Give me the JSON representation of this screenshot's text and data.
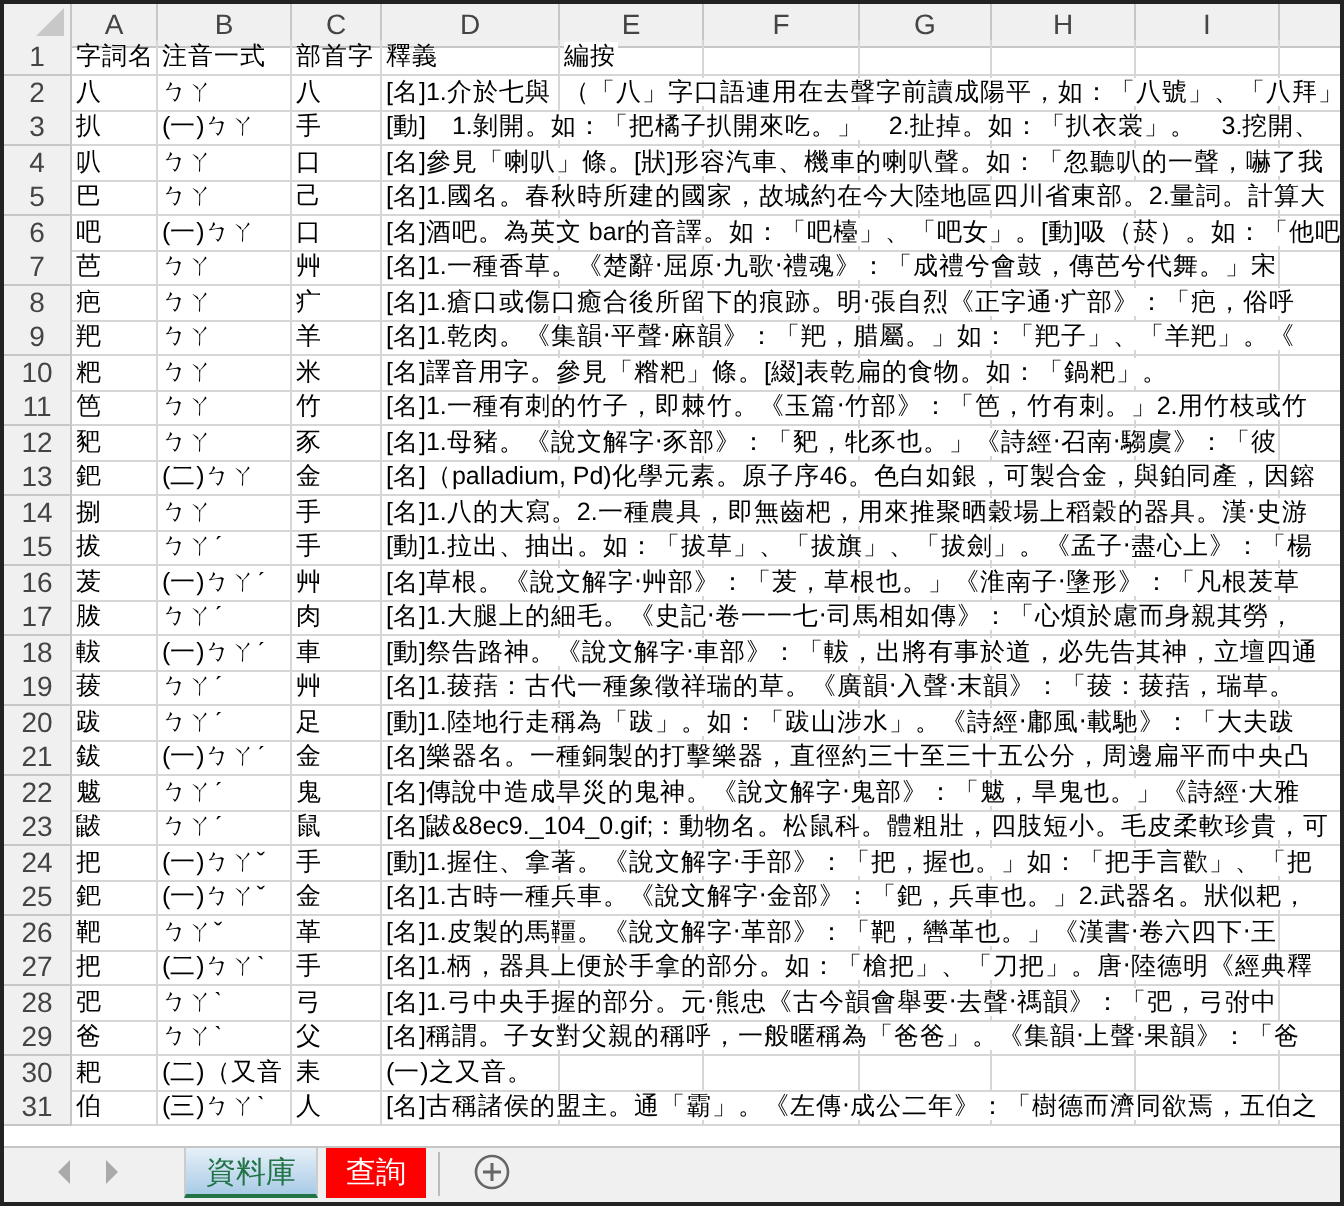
{
  "columns": [
    "A",
    "B",
    "C",
    "D",
    "E",
    "F",
    "G",
    "H",
    "I"
  ],
  "rows": [
    {
      "row_number": "1",
      "word": "字詞名",
      "zhuyin": "注音一式",
      "radical": "部首字",
      "definition": "釋義",
      "note": "編按"
    },
    {
      "row_number": "2",
      "word": "八",
      "zhuyin": "ㄅㄚ",
      "radical": "八",
      "definition": "[名]1.介於七與",
      "note": "（「八」字口語連用在去聲字前讀成陽平，如：「八號」、「八拜」"
    },
    {
      "row_number": "3",
      "word": "扒",
      "zhuyin": "(一)ㄅㄚ",
      "radical": "手",
      "definition": "[動]　1.剝開。如：「把橘子扒開來吃。」　2.扯掉。如：「扒衣裳」。　3.挖開、"
    },
    {
      "row_number": "4",
      "word": "叭",
      "zhuyin": "ㄅㄚ",
      "radical": "口",
      "definition": "[名]參見「喇叭」條。[狀]形容汽車、機車的喇叭聲。如：「忽聽叭的一聲，嚇了我"
    },
    {
      "row_number": "5",
      "word": "巴",
      "zhuyin": "ㄅㄚ",
      "radical": "己",
      "definition": "[名]1.國名。春秋時所建的國家，故城約在今大陸地區四川省東部。2.量詞。計算大"
    },
    {
      "row_number": "6",
      "word": "吧",
      "zhuyin": "(一)ㄅㄚ",
      "radical": "口",
      "definition": "[名]酒吧。為英文 bar的音譯。如：「吧檯」、「吧女」。[動]吸（菸）。如：「他吧"
    },
    {
      "row_number": "7",
      "word": "芭",
      "zhuyin": "ㄅㄚ",
      "radical": "艸",
      "definition": "[名]1.一種香草。《楚辭‧屈原‧九歌‧禮魂》：「成禮兮會鼓，傳芭兮代舞。」宋"
    },
    {
      "row_number": "8",
      "word": "疤",
      "zhuyin": "ㄅㄚ",
      "radical": "疒",
      "definition": "[名]1.瘡口或傷口癒合後所留下的痕跡。明‧張自烈《正字通‧疒部》：「疤，俗呼"
    },
    {
      "row_number": "9",
      "word": "羓",
      "zhuyin": "ㄅㄚ",
      "radical": "羊",
      "definition": "[名]1.乾肉。《集韻‧平聲‧麻韻》：「羓，腊屬。」如：「羓子」、「羊羓」。《"
    },
    {
      "row_number": "10",
      "word": "粑",
      "zhuyin": "ㄅㄚ",
      "radical": "米",
      "definition": "[名]譯音用字。參見「糌粑」條。[綴]表乾扁的食物。如：「鍋粑」。"
    },
    {
      "row_number": "11",
      "word": "笆",
      "zhuyin": "ㄅㄚ",
      "radical": "竹",
      "definition": "[名]1.一種有刺的竹子，即棘竹。《玉篇‧竹部》：「笆，竹有刺。」2.用竹枝或竹"
    },
    {
      "row_number": "12",
      "word": "豝",
      "zhuyin": "ㄅㄚ",
      "radical": "豕",
      "definition": "[名]1.母豬。《說文解字‧豕部》：「豝，牝豕也。」《詩經‧召南‧騶虞》：「彼"
    },
    {
      "row_number": "13",
      "word": "鈀",
      "zhuyin": "(二)ㄅㄚ",
      "radical": "金",
      "definition": "[名]（palladium, Pd)化學元素。原子序46。色白如銀，可製合金，與鉑同產，因鎔"
    },
    {
      "row_number": "14",
      "word": "捌",
      "zhuyin": "ㄅㄚ",
      "radical": "手",
      "definition": "[名]1.八的大寫。2.一種農具，即無齒杷，用來推聚晒穀場上稻穀的器具。漢‧史游"
    },
    {
      "row_number": "15",
      "word": "拔",
      "zhuyin": "ㄅㄚˊ",
      "radical": "手",
      "definition": "[動]1.拉出、抽出。如：「拔草」、「拔旗」、「拔劍」。《孟子‧盡心上》：「楊"
    },
    {
      "row_number": "16",
      "word": "茇",
      "zhuyin": "(一)ㄅㄚˊ",
      "radical": "艸",
      "definition": "[名]草根。《說文解字‧艸部》：「茇，草根也。」《淮南子‧墬形》：「凡根茇草"
    },
    {
      "row_number": "17",
      "word": "胈",
      "zhuyin": "ㄅㄚˊ",
      "radical": "肉",
      "definition": "[名]1.大腿上的細毛。《史記‧卷一一七‧司馬相如傳》：「心煩於慮而身親其勞，"
    },
    {
      "row_number": "18",
      "word": "軷",
      "zhuyin": "(一)ㄅㄚˊ",
      "radical": "車",
      "definition": "[動]祭告路神。《說文解字‧車部》：「軷，出將有事於道，必先告其神，立壇四通"
    },
    {
      "row_number": "19",
      "word": "菝",
      "zhuyin": "ㄅㄚˊ",
      "radical": "艸",
      "definition": "[名]1.菝葀：古代一種象徵祥瑞的草。《廣韻‧入聲‧末韻》：「菝：菝葀，瑞草。"
    },
    {
      "row_number": "20",
      "word": "跋",
      "zhuyin": "ㄅㄚˊ",
      "radical": "足",
      "definition": "[動]1.陸地行走稱為「跋」。如：「跋山涉水」。《詩經‧鄘風‧載馳》：「大夫跋"
    },
    {
      "row_number": "21",
      "word": "鈸",
      "zhuyin": "(一)ㄅㄚˊ",
      "radical": "金",
      "definition": "[名]樂器名。一種銅製的打擊樂器，直徑約三十至三十五公分，周邊扁平而中央凸"
    },
    {
      "row_number": "22",
      "word": "魃",
      "zhuyin": "ㄅㄚˊ",
      "radical": "鬼",
      "definition": "[名]傳說中造成旱災的鬼神。《說文解字‧鬼部》：「魃，旱鬼也。」《詩經‧大雅"
    },
    {
      "row_number": "23",
      "word": "鼥",
      "zhuyin": "ㄅㄚˊ",
      "radical": "鼠",
      "definition": "[名]鼥&8ec9._104_0.gif;：動物名。松鼠科。體粗壯，四肢短小。毛皮柔軟珍貴，可"
    },
    {
      "row_number": "24",
      "word": "把",
      "zhuyin": "(一)ㄅㄚˇ",
      "radical": "手",
      "definition": "[動]1.握住、拿著。《說文解字‧手部》：「把，握也。」如：「把手言歡」、「把"
    },
    {
      "row_number": "25",
      "word": "鈀",
      "zhuyin": "(一)ㄅㄚˇ",
      "radical": "金",
      "definition": "[名]1.古時一種兵車。《說文解字‧金部》：「鈀，兵車也。」2.武器名。狀似耙，"
    },
    {
      "row_number": "26",
      "word": "靶",
      "zhuyin": "ㄅㄚˇ",
      "radical": "革",
      "definition": "[名]1.皮製的馬韁。《說文解字‧革部》：「靶，轡革也。」《漢書‧卷六四下‧王"
    },
    {
      "row_number": "27",
      "word": "把",
      "zhuyin": "(二)ㄅㄚˋ",
      "radical": "手",
      "definition": "[名]1.柄，器具上便於手拿的部分。如：「槍把」、「刀把」。唐‧陸德明《經典釋"
    },
    {
      "row_number": "28",
      "word": "弝",
      "zhuyin": "ㄅㄚˋ",
      "radical": "弓",
      "definition": "[名]1.弓中央手握的部分。元‧熊忠《古今韻會舉要‧去聲‧禡韻》：「弝，弓弣中"
    },
    {
      "row_number": "29",
      "word": "爸",
      "zhuyin": "ㄅㄚˋ",
      "radical": "父",
      "definition": "[名]稱謂。子女對父親的稱呼，一般暱稱為「爸爸」。《集韻‧上聲‧果韻》：「爸"
    },
    {
      "row_number": "30",
      "word": "耙",
      "zhuyin": "(二)（又音",
      "radical": "耒",
      "definition": "(一)之又音。"
    },
    {
      "row_number": "31",
      "word": "伯",
      "zhuyin": "(三)ㄅㄚˋ",
      "radical": "人",
      "definition": "[名]古稱諸侯的盟主。通「霸」。《左傳‧成公二年》：「樹德而濟同欲焉，五伯之"
    }
  ],
  "sheet_tabs": [
    {
      "label": "資料庫",
      "selected": true
    },
    {
      "label": "查詢",
      "selected": false,
      "color": "#ff0000"
    }
  ]
}
